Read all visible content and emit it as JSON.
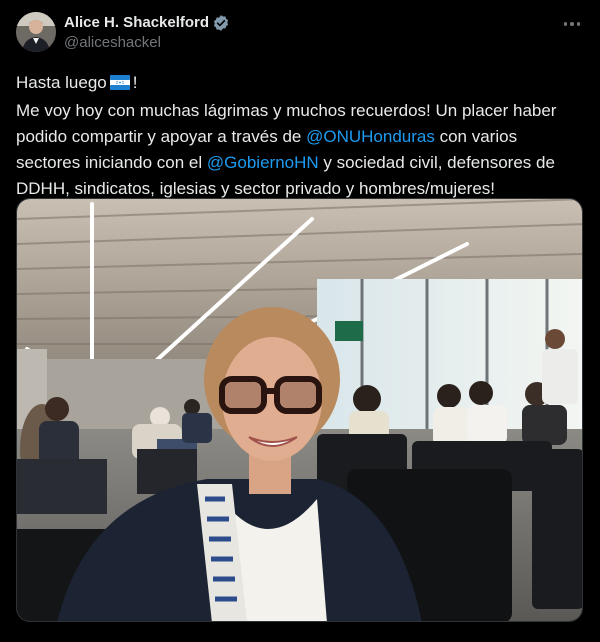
{
  "author": {
    "display_name": "Alice H. Shackelford",
    "handle": "@aliceshackel",
    "verified": true
  },
  "menu": {
    "icon": "more-horizontal-icon"
  },
  "tweet": {
    "line1_before": "Hasta luego",
    "line1_after": "!",
    "flag": "honduras-flag",
    "line2_a": "Me voy hoy con muchas lágrimas y muchos recuerdos! Un placer haber podido compartir y apoyar a través de",
    "mention1": "@ONUHonduras",
    "line2_b": "con varios sectores iniciando con el",
    "mention2": "@GobiernoHN",
    "line2_c": "y sociedad civil, defensores de DDHH, sindicatos, iglesias y sector privado y hombres/mujeres!"
  },
  "media": {
    "kind": "photo",
    "description_icon": "airport-selfie-photo"
  },
  "colors": {
    "background": "#000000",
    "text": "#e7e9ea",
    "muted": "#71767b",
    "link": "#1d9bf0",
    "verified": "#829aab"
  }
}
